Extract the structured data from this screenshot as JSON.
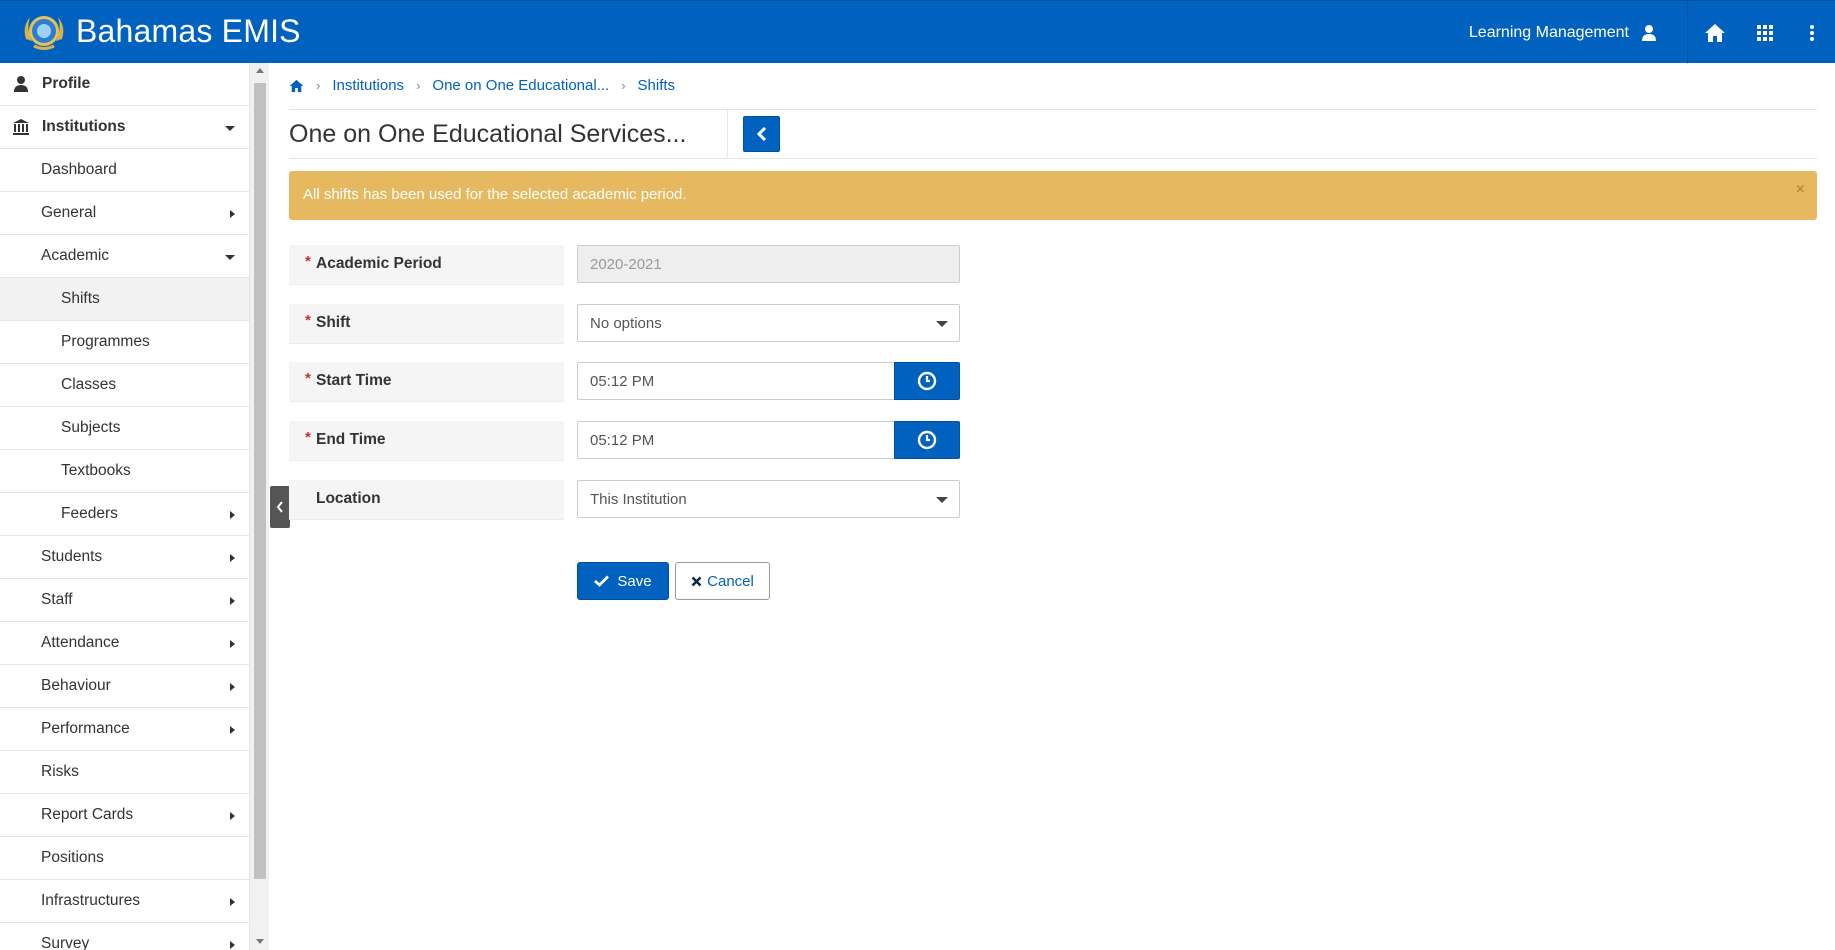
{
  "header": {
    "brand": "Bahamas EMIS",
    "user_label": "Learning Management",
    "bg_color": "#0062be"
  },
  "sidebar": {
    "items": [
      {
        "label": "Profile",
        "icon": "user-icon"
      },
      {
        "label": "Institutions",
        "icon": "institution-icon"
      },
      {
        "label": "Dashboard"
      },
      {
        "label": "General"
      },
      {
        "label": "Academic"
      },
      {
        "label": "Shifts",
        "active": true
      },
      {
        "label": "Programmes"
      },
      {
        "label": "Classes"
      },
      {
        "label": "Subjects"
      },
      {
        "label": "Textbooks"
      },
      {
        "label": "Feeders"
      },
      {
        "label": "Students"
      },
      {
        "label": "Staff"
      },
      {
        "label": "Attendance"
      },
      {
        "label": "Behaviour"
      },
      {
        "label": "Performance"
      },
      {
        "label": "Risks"
      },
      {
        "label": "Report Cards"
      },
      {
        "label": "Positions"
      },
      {
        "label": "Infrastructures"
      },
      {
        "label": "Survey"
      }
    ]
  },
  "breadcrumb": [
    "Institutions",
    "One on One Educational...",
    "Shifts"
  ],
  "page_title": "One on One Educational Services...",
  "alert": {
    "message": "All shifts has been used for the selected academic period.",
    "close": "×",
    "color": "#e6b85f"
  },
  "form": {
    "academic_period": {
      "label": "Academic Period",
      "value": "2020-2021"
    },
    "shift": {
      "label": "Shift",
      "value": "No options"
    },
    "start_time": {
      "label": "Start Time",
      "value": "05:12 PM"
    },
    "end_time": {
      "label": "End Time",
      "value": "05:12 PM"
    },
    "location": {
      "label": "Location",
      "value": "This Institution"
    },
    "required_mark": "*"
  },
  "actions": {
    "save": "Save",
    "cancel": "Cancel"
  }
}
